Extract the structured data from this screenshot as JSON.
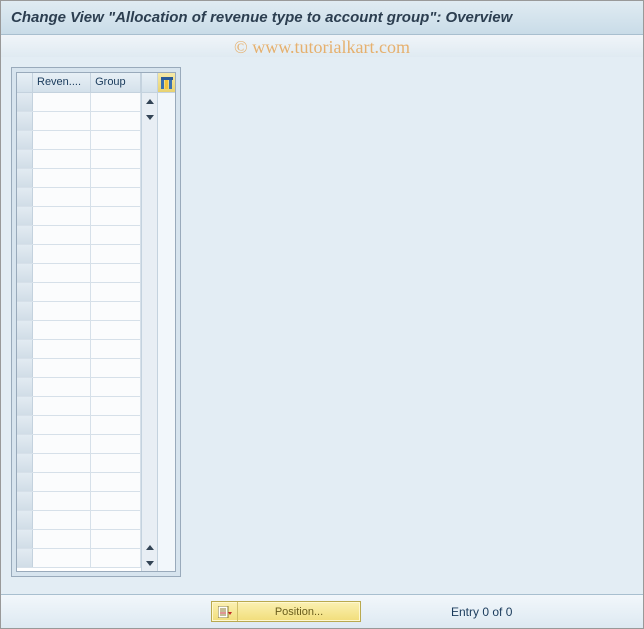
{
  "title": "Change View \"Allocation of revenue type to account group\": Overview",
  "watermark": "© www.tutorialkart.com",
  "table": {
    "columns": [
      "Reven....",
      "Group"
    ],
    "row_count": 25
  },
  "footer": {
    "position_label": "Position...",
    "entry_status": "Entry 0 of 0"
  }
}
